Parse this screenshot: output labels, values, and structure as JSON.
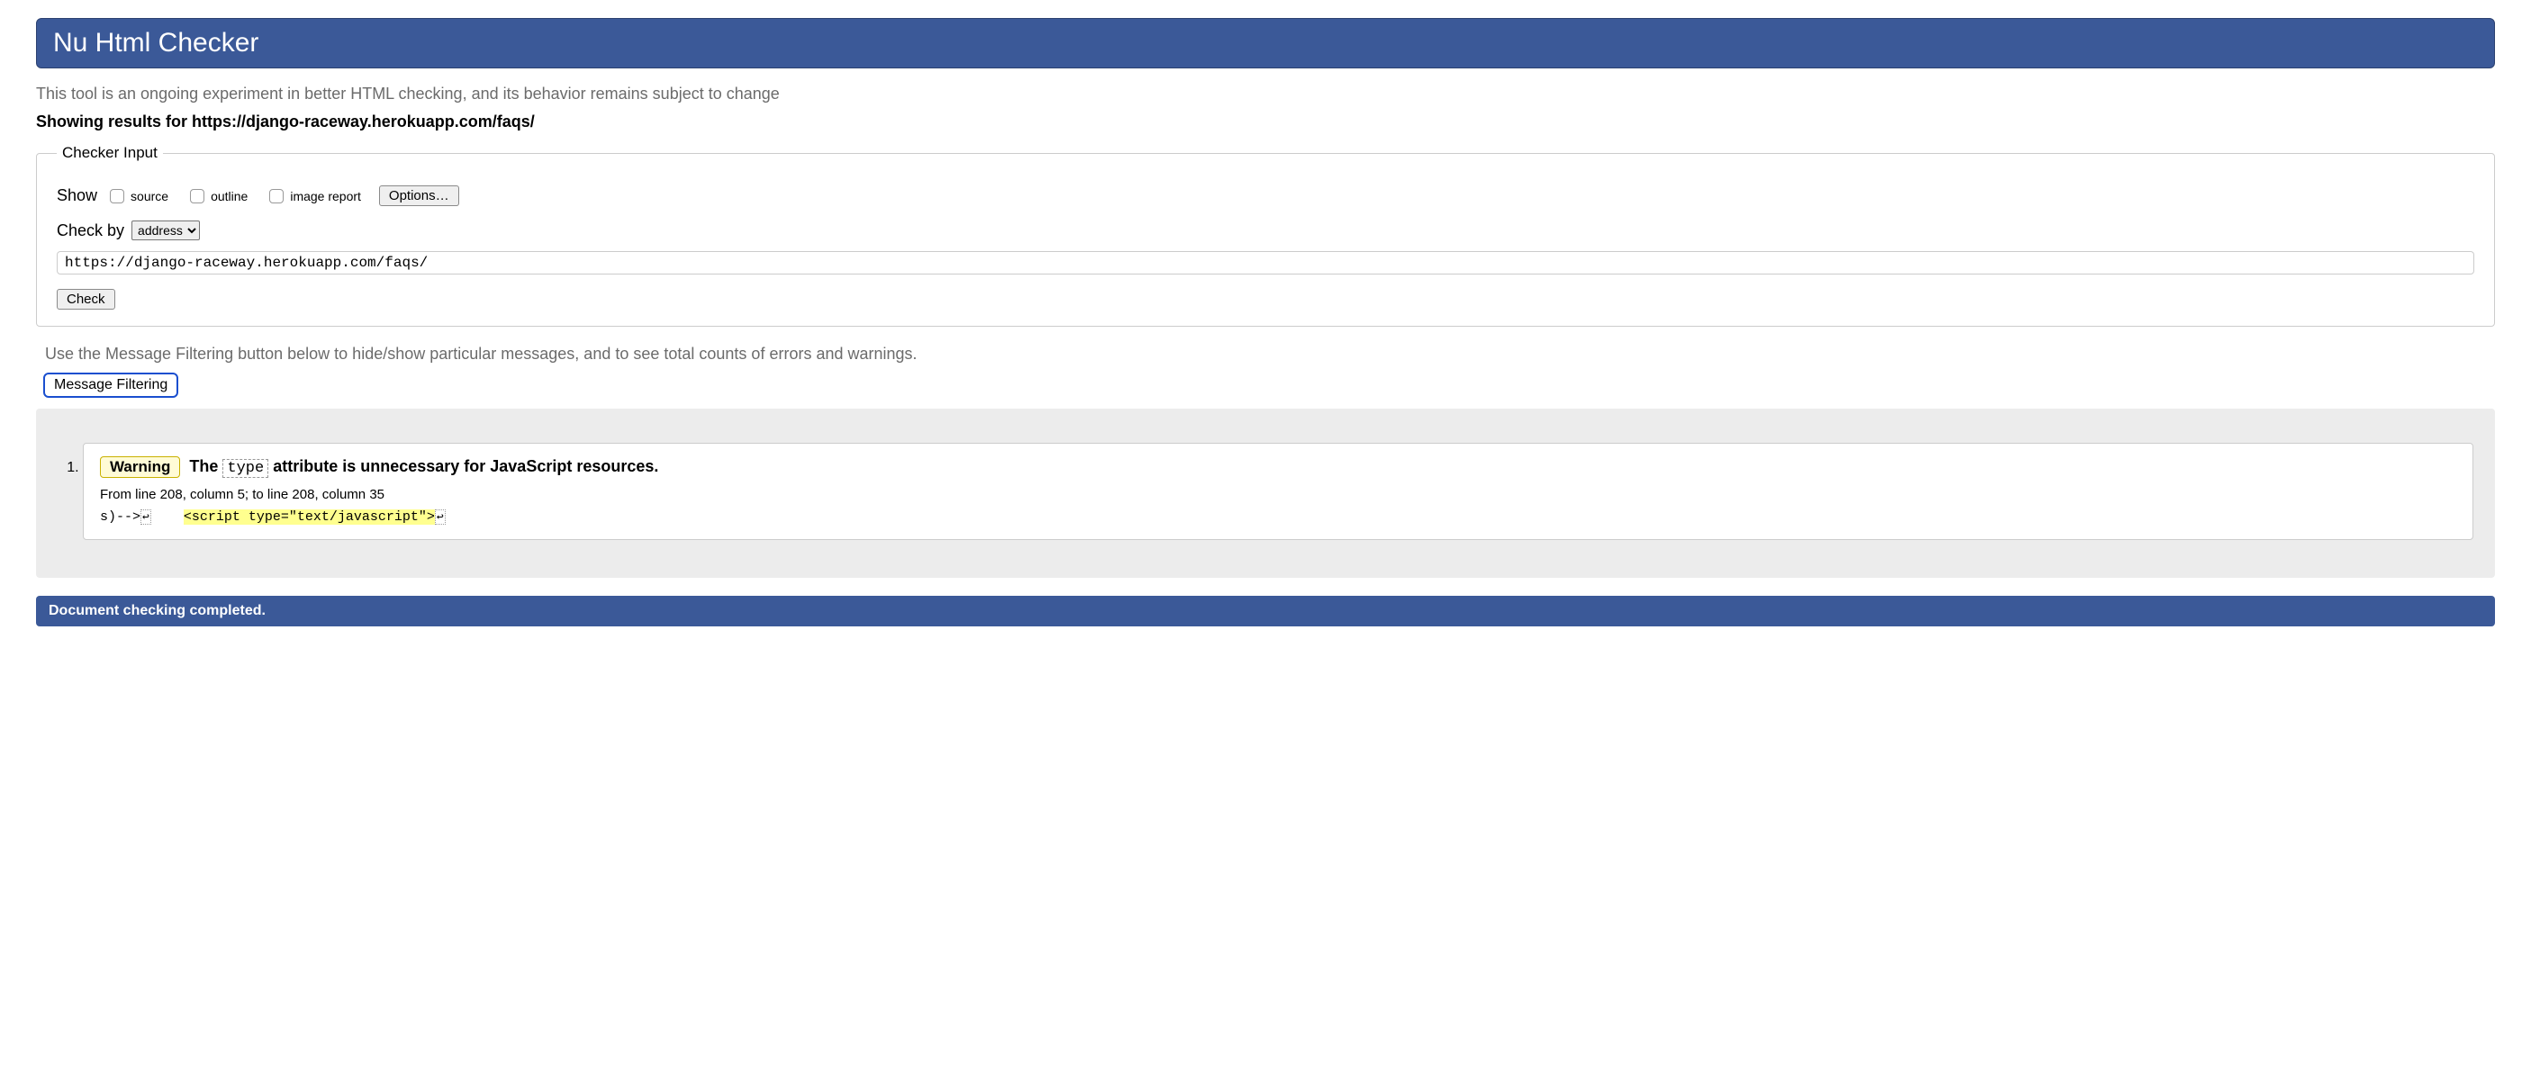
{
  "header": {
    "title": "Nu Html Checker"
  },
  "intro": "This tool is an ongoing experiment in better HTML checking, and its behavior remains subject to change",
  "results_for_prefix": "Showing results for ",
  "results_for_url": "https://django-raceway.herokuapp.com/faqs/",
  "checker_input": {
    "legend": "Checker Input",
    "show_label": "Show",
    "cb_source": "source",
    "cb_outline": "outline",
    "cb_image_report": "image report",
    "options_btn": "Options…",
    "checkby_label": "Check by",
    "checkby_selected": "address",
    "address_value": "https://django-raceway.herokuapp.com/faqs/",
    "check_btn": "Check"
  },
  "filter_note": "Use the Message Filtering button below to hide/show particular messages, and to see total counts of errors and warnings.",
  "filter_btn": "Message Filtering",
  "messages": [
    {
      "index": "1.",
      "badge": "Warning",
      "text_before": "The ",
      "code": "type",
      "text_after": " attribute is unnecessary for JavaScript resources.",
      "location": "From line 208, column 5; to line 208, column 35",
      "snippet_pre": "s)-->",
      "snippet_nl1": "↩",
      "snippet_gap": "    ",
      "snippet_hl": "<script type=\"text/javascript\">",
      "snippet_nl2": "↩"
    }
  ],
  "completed": "Document checking completed."
}
